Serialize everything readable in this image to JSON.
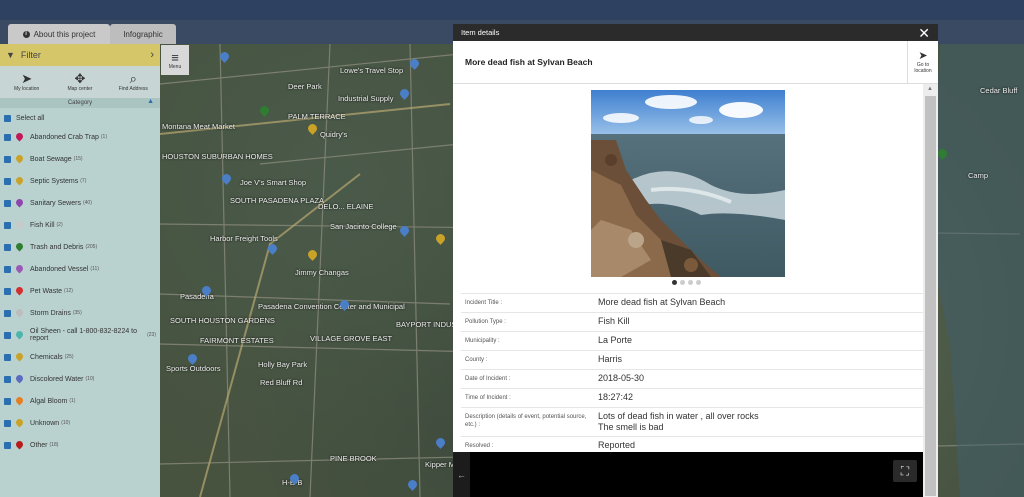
{
  "tabs": [
    {
      "label": "About this project",
      "icon": "info-icon"
    },
    {
      "label": "Infographic"
    }
  ],
  "filter": {
    "label": "Filter",
    "icon": "filter-icon"
  },
  "tools": [
    {
      "label": "My location",
      "icon": "location-arrow-icon"
    },
    {
      "label": "Map center",
      "icon": "crosshair-icon"
    },
    {
      "label": "Find Address",
      "icon": "search-icon"
    }
  ],
  "menu": {
    "label": "Menu"
  },
  "category": {
    "header": "Category"
  },
  "categories": [
    {
      "label": "Select all",
      "count": "",
      "color": ""
    },
    {
      "label": "Abandoned Crab Trap",
      "count": "(1)",
      "color": "#c2185b"
    },
    {
      "label": "Boat Sewage",
      "count": "(15)",
      "color": "#c9a227"
    },
    {
      "label": "Septic Systems",
      "count": "(7)",
      "color": "#c9a227"
    },
    {
      "label": "Sanitary Sewers",
      "count": "(40)",
      "color": "#8e44ad"
    },
    {
      "label": "Fish Kill",
      "count": "(2)",
      "color": "#c9c9c9"
    },
    {
      "label": "Trash and Debris",
      "count": "(205)",
      "color": "#2e7d32"
    },
    {
      "label": "Abandoned Vessel",
      "count": "(11)",
      "color": "#9b59b6"
    },
    {
      "label": "Pet Waste",
      "count": "(12)",
      "color": "#d32f2f"
    },
    {
      "label": "Storm Drains",
      "count": "(35)",
      "color": "#bdbdbd"
    },
    {
      "label": "Oil Sheen - call 1-800-832-8224 to report",
      "count": "(23)",
      "color": "#4db6ac"
    },
    {
      "label": "Chemicals",
      "count": "(25)",
      "color": "#c9a227"
    },
    {
      "label": "Discolored Water",
      "count": "(10)",
      "color": "#5c6bc0"
    },
    {
      "label": "Algal Bloom",
      "count": "(1)",
      "color": "#e67e22"
    },
    {
      "label": "Unknown",
      "count": "(10)",
      "color": "#c9a227"
    },
    {
      "label": "Other",
      "count": "(18)",
      "color": "#b71c1c"
    }
  ],
  "map_labels": [
    "Deer Park",
    "PALM TERRACE",
    "Quidry's",
    "Industrial Supply",
    "Montana Meat Market",
    "HOUSTON SUBURBAN HOMES",
    "SOUTH PASADENA PLAZA",
    "DELO... ELAINE",
    "San Jacinto College",
    "Jimmy Changas",
    "Harbor Freight Tools",
    "Pasadena Convention Center and Municipal",
    "SOUTH HOUSTON GARDENS",
    "FAIRMONT ESTATES",
    "VILLAGE GROVE EAST",
    "Holly Bay Park",
    "PINE BROOK",
    "Kipper Mease",
    "Camp",
    "Cedar Bluff",
    "Lowe's Travel Stop",
    "Joe V's Smart Shop",
    "Red Bluff Rd",
    "Pasadena",
    "H-E-B",
    "Sports Outdoors",
    "BAYPORT INDUSTRIAL"
  ],
  "modal": {
    "header": "Item details",
    "title": "More dead fish at Sylvan Beach",
    "goto": "Go to location",
    "fields": [
      {
        "label": "Incident Title :",
        "value": "More dead fish at Sylvan Beach"
      },
      {
        "label": "Pollution Type :",
        "value": "Fish Kill"
      },
      {
        "label": "Municipality :",
        "value": "La Porte"
      },
      {
        "label": "County :",
        "value": "Harris"
      },
      {
        "label": "Date of Incident :",
        "value": "2018-05-30"
      },
      {
        "label": "Time of Incident :",
        "value": "18:27:42"
      },
      {
        "label": "Description (details of event, potential source, etc.) :",
        "value": "Lots of dead fish in water , all over rocks\nThe smell is bad"
      },
      {
        "label": "Resolved :",
        "value": "Reported"
      }
    ],
    "photo_dots": 4,
    "photo_active": 0
  }
}
